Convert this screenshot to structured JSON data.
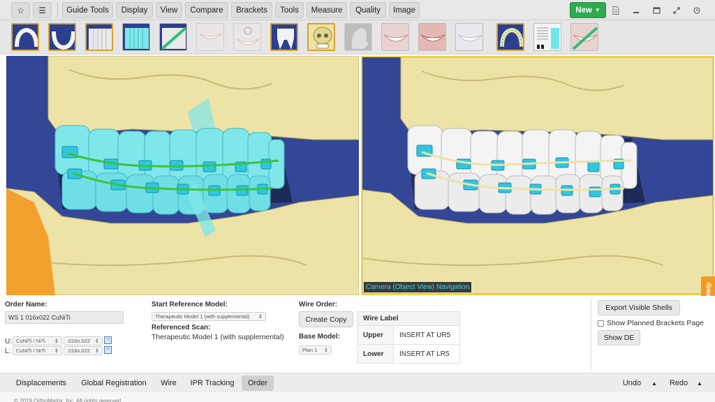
{
  "toolbar": {
    "star_icon": "star-icon",
    "list_icon": "list-icon",
    "menus": [
      "Guide Tools",
      "Display",
      "View",
      "Compare",
      "Brackets",
      "Tools",
      "Measure",
      "Quality",
      "Image"
    ],
    "new_label": "New",
    "window_icons": [
      "document-icon",
      "minimize-icon",
      "maximize-icon",
      "fullscreen-icon",
      "clock-icon"
    ]
  },
  "thumbnails": [
    "upper-arch-view",
    "lower-arch-view",
    "front-teeth-view",
    "teeth-overlay-view",
    "teeth-overlay-slash-view",
    "smile-view-dim",
    "smile-timer-view-dim",
    "molar-view",
    "skull-view",
    "xray-profile-view-dim",
    "smile-photo-view",
    "smile-braces-photo-view",
    "smile-retainer-view",
    "arch-brackets-view",
    "chart-view",
    "smile-slash-view"
  ],
  "viewports": {
    "right_caption": "Camera (Object View) Navigation"
  },
  "order": {
    "order_name_label": "Order Name:",
    "order_name_value": "WS  1 016x022 CuNiTi",
    "upper_prefix": "U:",
    "lower_prefix": "L:",
    "upper_material": "CuNiTi / NiTi",
    "upper_size": ".016x.022",
    "lower_material": "CuNiTi / NiTi",
    "lower_size": ".016x.022",
    "start_ref_label": "Start Reference Model:",
    "start_ref_value": "Therapeutic Model 1 (with supplemental)",
    "ref_scan_label": "Referenced Scan:",
    "ref_scan_value": "Therapeutic Model 1 (with supplemental)",
    "wire_order_label": "Wire Order:",
    "create_copy_label": "Create Copy",
    "base_model_label": "Base Model:",
    "base_model_value": "Plan 1",
    "wire_label_header": "Wire Label",
    "upper_row_label": "Upper",
    "upper_row_value": "INSERT AT UR5",
    "lower_row_label": "Lower",
    "lower_row_value": "INSERT AT LR5",
    "export_label": "Export Visible Shells",
    "show_planned_label": "Show Planned Brackets Page",
    "show_de_label": "Show DE"
  },
  "self_help": "Self Help",
  "tabs": [
    "Displacements",
    "Global Registration",
    "Wire",
    "IPR Tracking",
    "Order"
  ],
  "active_tab": "Order",
  "undo_label": "Undo",
  "redo_label": "Redo",
  "footer": "© 2019 OrthoMatrix, Inc. All rights reserved.",
  "colors": {
    "viewport_bg": "#334796",
    "bone": "#ede3a6",
    "teeth_cyan": "#6fe4ea",
    "bracket": "#2fc7e0",
    "wire_green": "#39c43a",
    "new_green": "#2eaa4f",
    "self_help": "#f39a24",
    "selection_border": "#f0d24a"
  }
}
